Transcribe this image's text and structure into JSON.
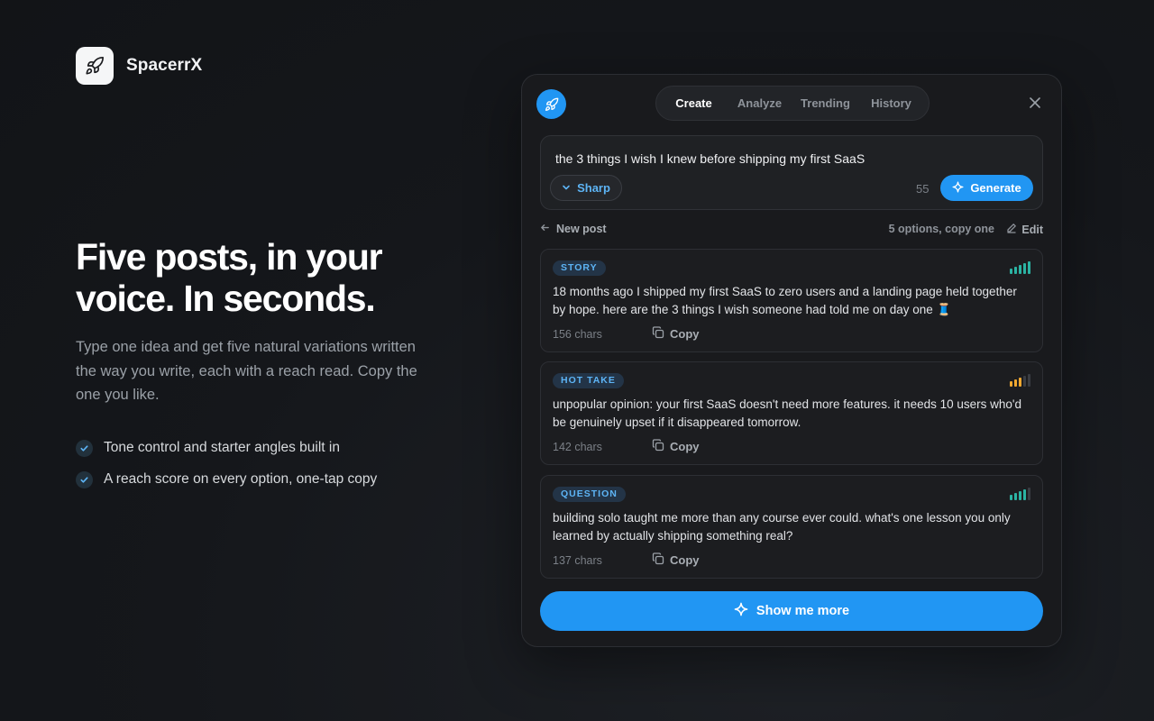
{
  "brand": {
    "name": "SpacerrX",
    "icon": "rocket-icon"
  },
  "hero": {
    "title_line1": "Five posts, in your",
    "title_line2": "voice. In seconds.",
    "subtitle": "Type one idea and get five natural variations written the way you write, each with a reach read. Copy the one you like.",
    "features": [
      "Tone control and starter angles built in",
      "A reach score on every option, one-tap copy"
    ]
  },
  "panel": {
    "tabs": [
      {
        "label": "Create",
        "active": true
      },
      {
        "label": "Analyze",
        "active": false
      },
      {
        "label": "Trending",
        "active": false
      },
      {
        "label": "History",
        "active": false
      }
    ],
    "composer": {
      "prompt": "the 3 things I wish I knew before shipping my first SaaS",
      "tone": "Sharp",
      "char_count": "55",
      "generate_label": "Generate"
    },
    "subbar": {
      "new_post": "New post",
      "options_note": "5 options, copy one",
      "edit": "Edit"
    },
    "posts": [
      {
        "tag": "STORY",
        "text": "18 months ago I shipped my first SaaS to zero users and a landing page held together by hope. here are the 3 things I wish someone had told me on day one 🧵",
        "chars": "156 chars",
        "copy": "Copy",
        "reach_level": 5,
        "reach_color": "#2bb3a3"
      },
      {
        "tag": "HOT TAKE",
        "text": "unpopular opinion: your first SaaS doesn't need more features. it needs 10 users who'd be genuinely upset if it disappeared tomorrow.",
        "chars": "142 chars",
        "copy": "Copy",
        "reach_level": 3,
        "reach_color": "#f0a830"
      },
      {
        "tag": "QUESTION",
        "text": "building solo taught me more than any course ever could. what's one lesson you only learned by actually shipping something real?",
        "chars": "137 chars",
        "copy": "Copy",
        "reach_level": 4,
        "reach_color": "#2bb3a3"
      }
    ],
    "more_label": "Show me more"
  },
  "colors": {
    "accent": "#2196f3",
    "tag_text": "#5db4f5",
    "reach_high": "#2bb3a3",
    "reach_mid": "#f0a830",
    "reach_off": "#3a3d43"
  }
}
